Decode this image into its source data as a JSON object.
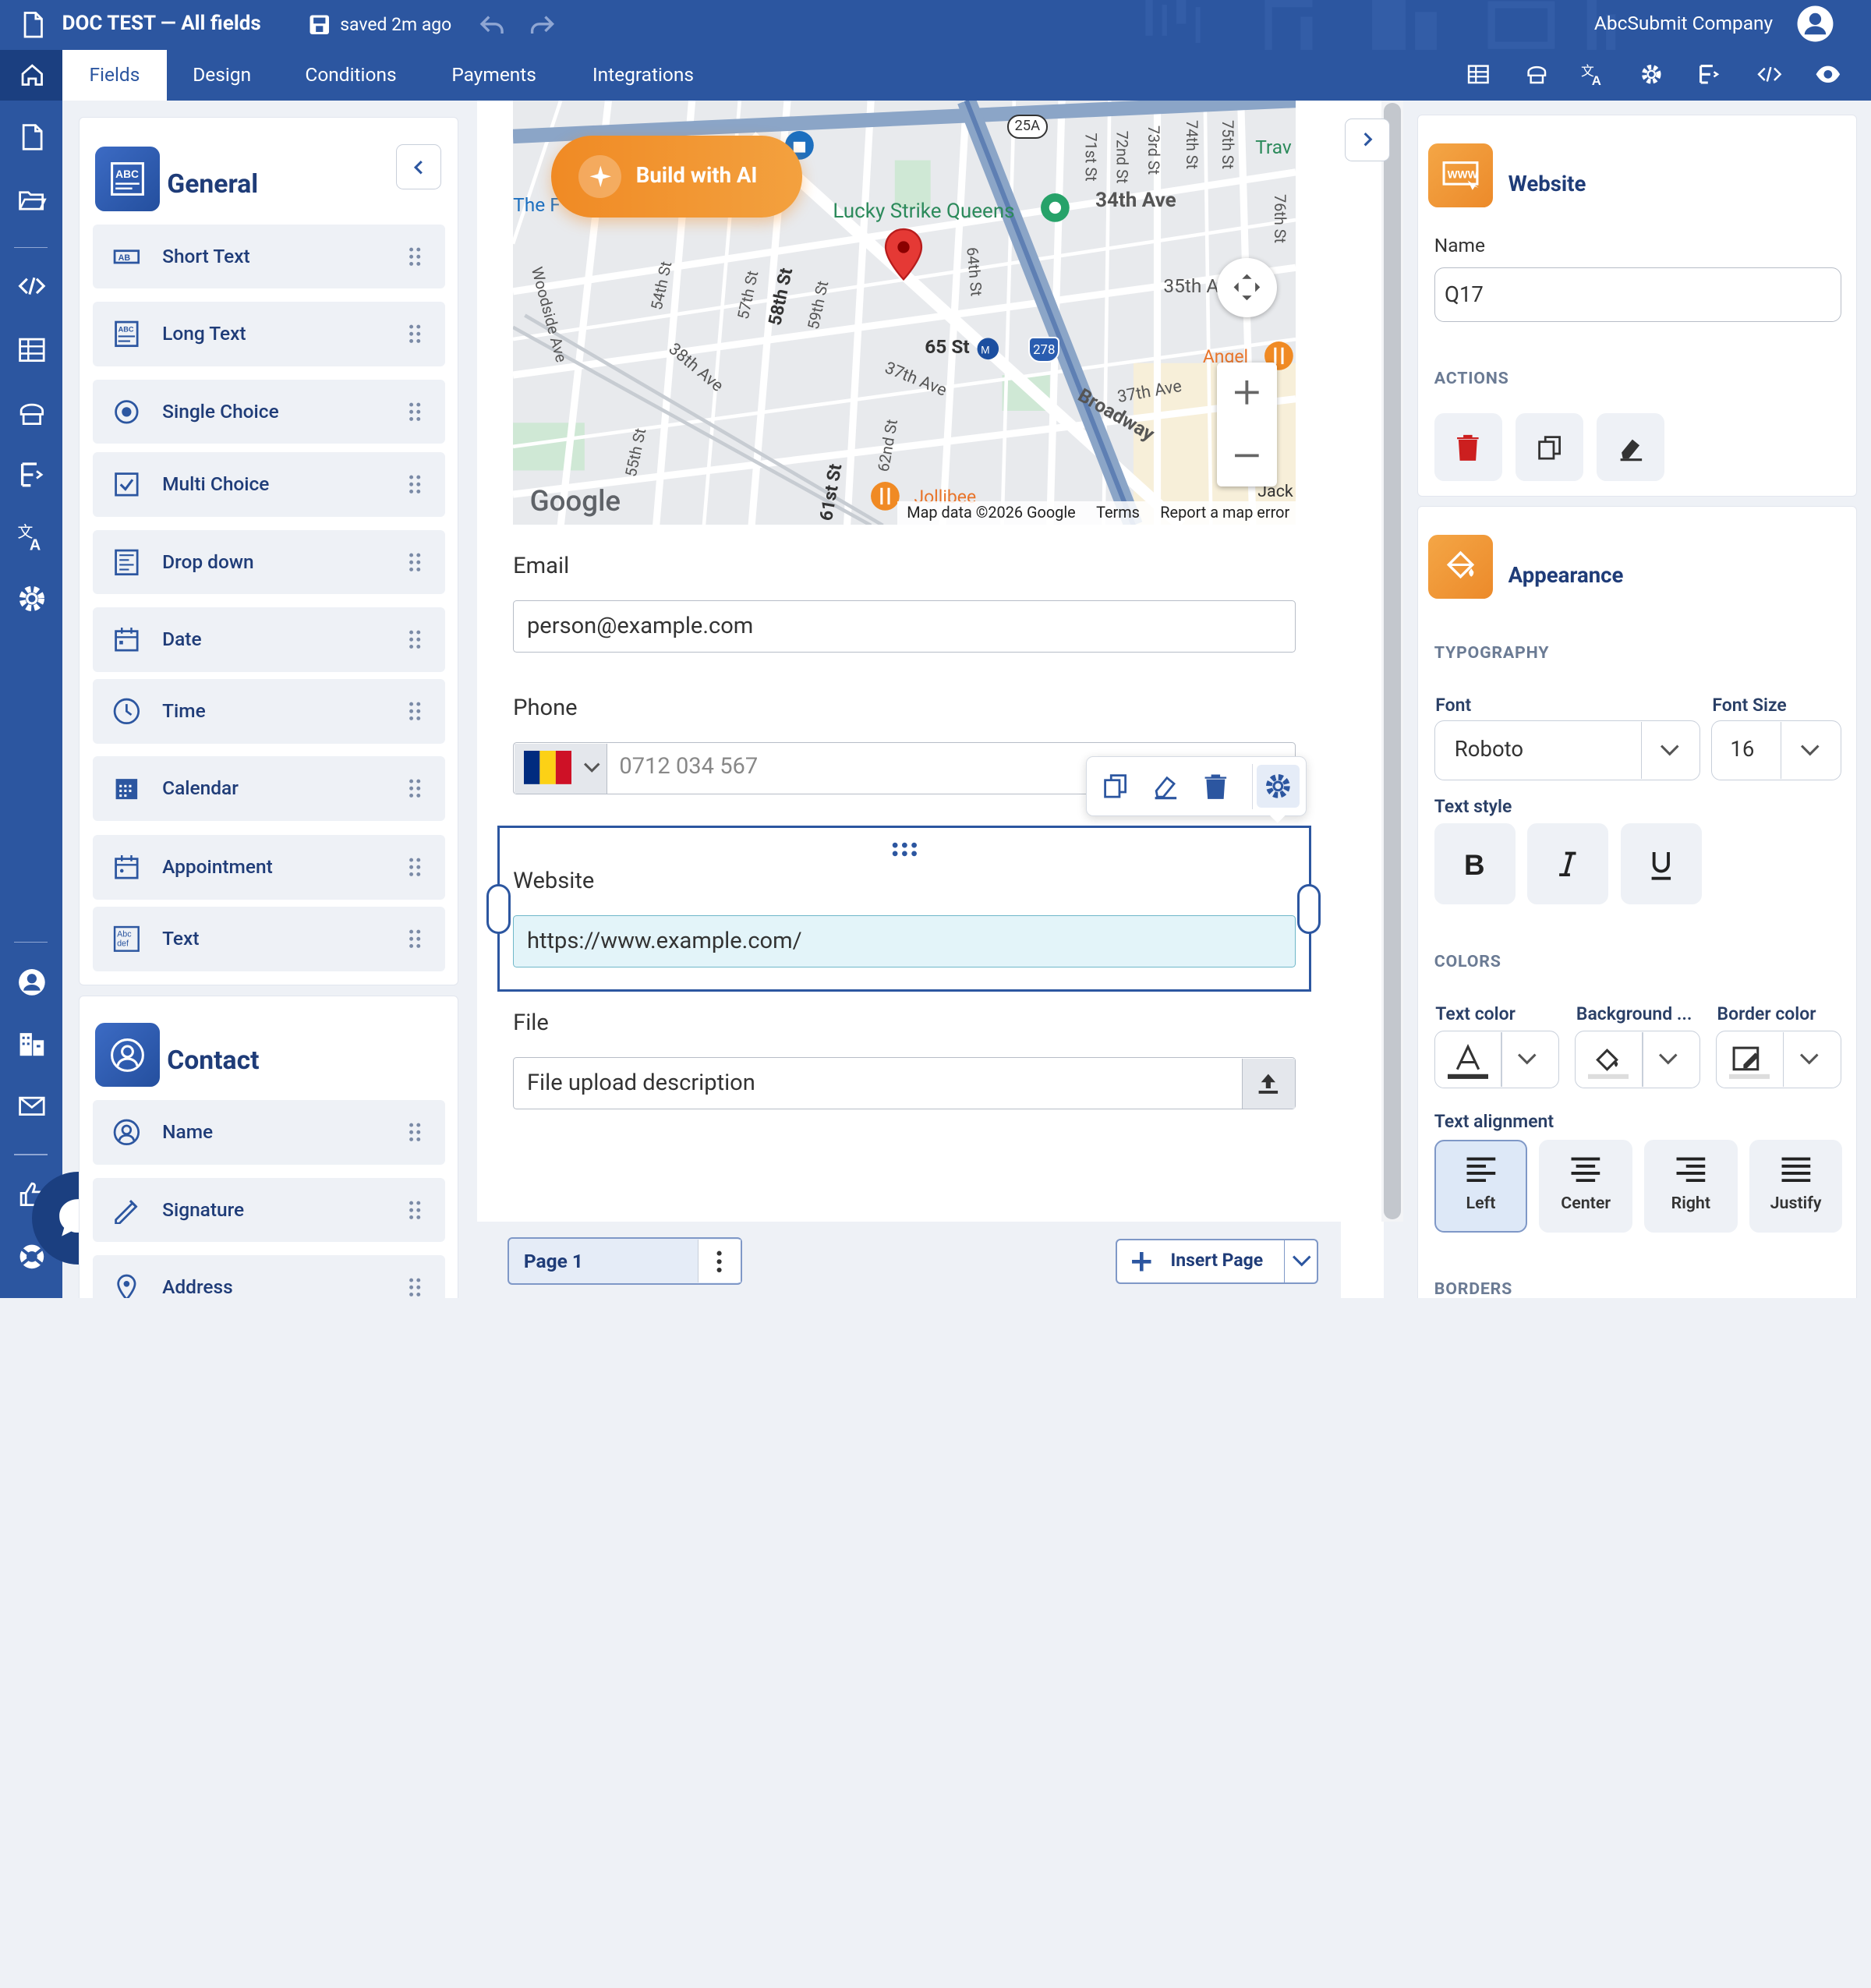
{
  "header": {
    "doc_title": "DOC TEST — All fields",
    "saved_status": "saved 2m ago",
    "company": "AbcSubmit Company",
    "tabs": [
      "Fields",
      "Design",
      "Conditions",
      "Payments",
      "Integrations"
    ],
    "active_tab": "Fields",
    "colors": {
      "brand": "#2c56a0",
      "brand_dark": "#1b3f80",
      "accent": "#f08a24"
    }
  },
  "sidebar": {
    "general": {
      "title": "General",
      "items": [
        {
          "label": "Short Text",
          "icon": "short-text-icon"
        },
        {
          "label": "Long Text",
          "icon": "long-text-icon"
        },
        {
          "label": "Single Choice",
          "icon": "radio-icon"
        },
        {
          "label": "Multi Choice",
          "icon": "checkbox-icon"
        },
        {
          "label": "Drop down",
          "icon": "dropdown-icon"
        },
        {
          "label": "Date",
          "icon": "date-icon"
        },
        {
          "label": "Time",
          "icon": "clock-icon"
        },
        {
          "label": "Calendar",
          "icon": "calendar-icon"
        },
        {
          "label": "Appointment",
          "icon": "appointment-icon"
        },
        {
          "label": "Text",
          "icon": "text-block-icon"
        }
      ]
    },
    "contact": {
      "title": "Contact",
      "items": [
        {
          "label": "Name",
          "icon": "person-icon"
        },
        {
          "label": "Signature",
          "icon": "signature-icon"
        },
        {
          "label": "Address",
          "icon": "location-icon"
        }
      ]
    }
  },
  "canvas": {
    "build_ai": "Build with AI",
    "map": {
      "place": "Lucky Strike Queens",
      "streets": [
        "34th Ave",
        "35th A",
        "37th Ave",
        "37th Ave",
        "38th Ave",
        "Broadway",
        "65 St",
        "Woodside Ave",
        "54th St",
        "55th St",
        "57th St",
        "58th St",
        "59th St",
        "61st St",
        "62nd St",
        "64th St",
        "71st St",
        "72nd St",
        "73rd St",
        "74th St",
        "75th St",
        "76th St",
        "Angel",
        "Jollibee",
        "Trav",
        "The F",
        "Jack"
      ],
      "route_badges": [
        "25A",
        "278"
      ],
      "attribution": [
        "Map data ©2026 Google",
        "Terms",
        "Report a map error"
      ],
      "logo": "Google"
    },
    "email": {
      "label": "Email",
      "value": "person@example.com"
    },
    "phone": {
      "label": "Phone",
      "placeholder": "0712 034 567",
      "country": "RO"
    },
    "website": {
      "label": "Website",
      "value": "https://www.example.com/"
    },
    "file": {
      "label": "File",
      "placeholder": "File upload description"
    },
    "footer": {
      "page": "Page 1",
      "insert": "Insert Page"
    }
  },
  "props": {
    "website_title": "Website",
    "name_label": "Name",
    "name_value": "Q17",
    "actions_label": "ACTIONS",
    "appearance_title": "Appearance",
    "typography_label": "TYPOGRAPHY",
    "font_label": "Font",
    "font_value": "Roboto",
    "font_size_label": "Font Size",
    "font_size_value": "16",
    "text_style_label": "Text style",
    "colors_label": "COLORS",
    "text_color_label": "Text color",
    "bg_label": "Background ...",
    "border_color_label": "Border color",
    "text_align_label": "Text alignment",
    "align": [
      "Left",
      "Center",
      "Right",
      "Justify"
    ],
    "align_active": "Left",
    "borders_label": "BORDERS",
    "delete_color": "#cc1f1f"
  }
}
